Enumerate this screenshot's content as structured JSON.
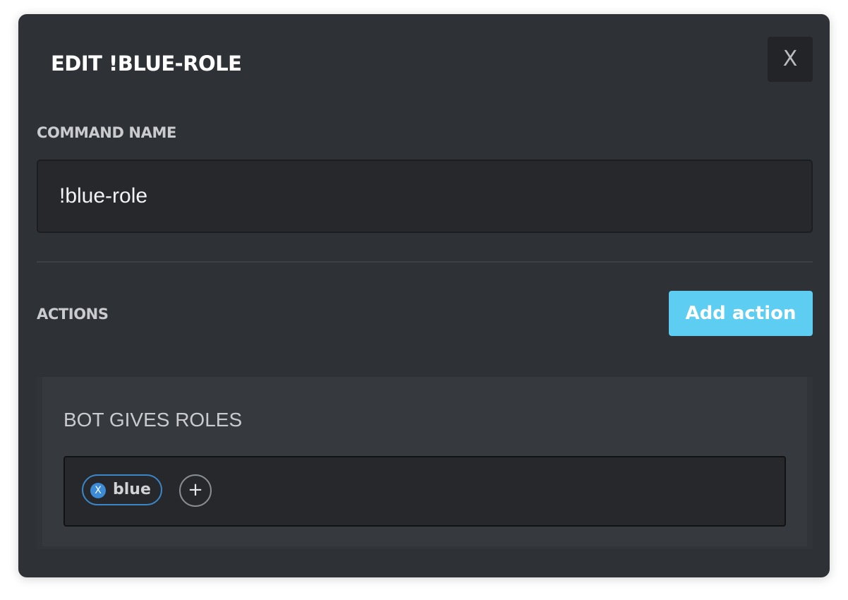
{
  "modal": {
    "title": "EDIT !BLUE-ROLE",
    "close_label": "X"
  },
  "command_name": {
    "label": "COMMAND NAME",
    "value": "!blue-role"
  },
  "actions": {
    "label": "ACTIONS",
    "add_button_label": "Add action",
    "items": [
      {
        "title": "BOT GIVES ROLES",
        "roles": [
          {
            "name": "blue",
            "remove_label": "X"
          }
        ],
        "add_role_label": "+"
      }
    ]
  },
  "colors": {
    "modal_background": "#2e3135",
    "accent": "#5dcdf2",
    "role_chip_border": "#3b86c7",
    "role_chip_remove": "#3b8bd6"
  },
  "icons": {
    "close": "close-icon",
    "chip_remove": "remove-role-icon",
    "add_role": "plus-icon"
  }
}
